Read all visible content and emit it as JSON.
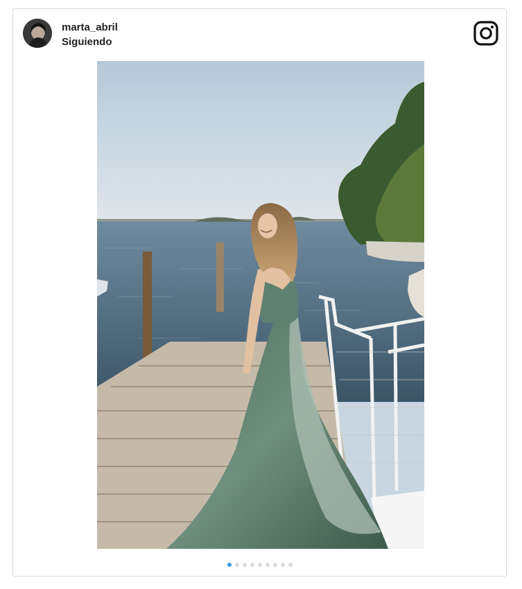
{
  "post": {
    "username": "marta_abril",
    "follow_status": "Siguiendo"
  },
  "icons": {
    "platform": "instagram-icon",
    "avatar": "profile-avatar"
  },
  "carousel": {
    "total": 9,
    "active_index": 0
  },
  "colors": {
    "accent_dot": "#3897f0",
    "inactive_dot": "#dbdbdb",
    "border": "#d9d9d9"
  }
}
